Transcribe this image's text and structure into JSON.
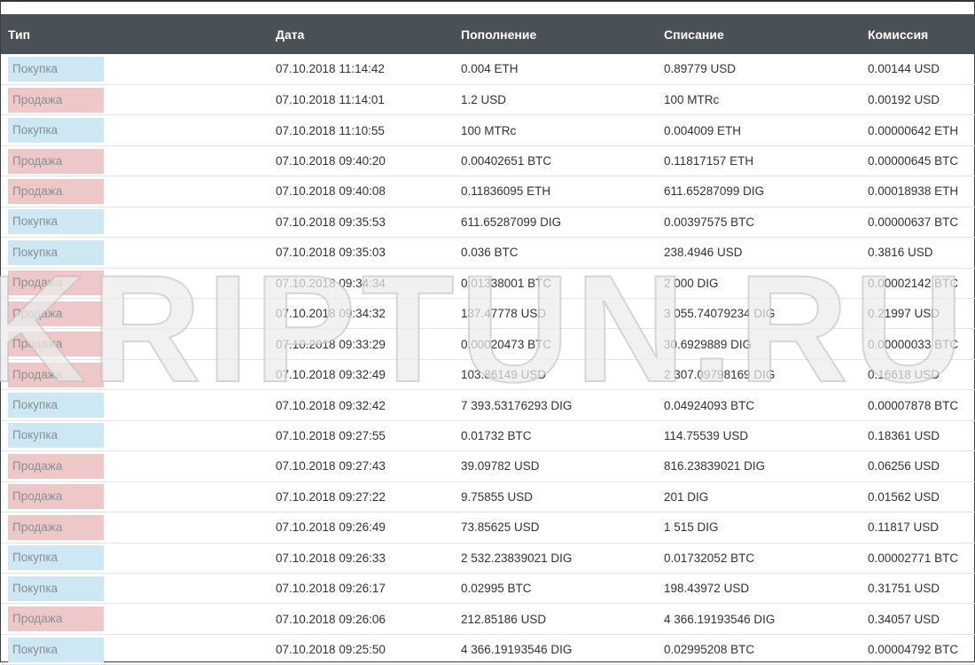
{
  "table": {
    "headers": {
      "type": "Тип",
      "date": "Дата",
      "deposit": "Пополнение",
      "withdrawal": "Списание",
      "fee": "Комиссия"
    },
    "rows": [
      {
        "type": "Покупка",
        "kind": "buy",
        "date": "07.10.2018 11:14:42",
        "deposit": "0.004 ETH",
        "withdrawal": "0.89779 USD",
        "fee": "0.00144 USD"
      },
      {
        "type": "Продажа",
        "kind": "sell",
        "date": "07.10.2018 11:14:01",
        "deposit": "1.2 USD",
        "withdrawal": "100 MTRc",
        "fee": "0.00192 USD"
      },
      {
        "type": "Покупка",
        "kind": "buy",
        "date": "07.10.2018 11:10:55",
        "deposit": "100 MTRc",
        "withdrawal": "0.004009 ETH",
        "fee": "0.00000642 ETH"
      },
      {
        "type": "Продажа",
        "kind": "sell",
        "date": "07.10.2018 09:40:20",
        "deposit": "0.00402651 BTC",
        "withdrawal": "0.11817157 ETH",
        "fee": "0.00000645 BTC"
      },
      {
        "type": "Продажа",
        "kind": "sell",
        "date": "07.10.2018 09:40:08",
        "deposit": "0.11836095 ETH",
        "withdrawal": "611.65287099 DIG",
        "fee": "0.00018938 ETH"
      },
      {
        "type": "Покупка",
        "kind": "buy",
        "date": "07.10.2018 09:35:53",
        "deposit": "611.65287099 DIG",
        "withdrawal": "0.00397575 BTC",
        "fee": "0.00000637 BTC"
      },
      {
        "type": "Покупка",
        "kind": "buy",
        "date": "07.10.2018 09:35:03",
        "deposit": "0.036 BTC",
        "withdrawal": "238.4946 USD",
        "fee": "0.3816 USD"
      },
      {
        "type": "Продажа",
        "kind": "sell",
        "date": "07.10.2018 09:34:34",
        "deposit": "0.01338001 BTC",
        "withdrawal": "2 000 DIG",
        "fee": "0.00002142 BTC"
      },
      {
        "type": "Продажа",
        "kind": "sell",
        "date": "07.10.2018 09:34:32",
        "deposit": "137.47778 USD",
        "withdrawal": "3 055.74079234 DIG",
        "fee": "0.21997 USD"
      },
      {
        "type": "Продажа",
        "kind": "sell",
        "date": "07.10.2018 09:33:29",
        "deposit": "0.00020473 BTC",
        "withdrawal": "30.6929889 DIG",
        "fee": "0.00000033 BTC"
      },
      {
        "type": "Продажа",
        "kind": "sell",
        "date": "07.10.2018 09:32:49",
        "deposit": "103.86149 USD",
        "withdrawal": "2 307.09798169 DIG",
        "fee": "0.16618 USD"
      },
      {
        "type": "Покупка",
        "kind": "buy",
        "date": "07.10.2018 09:32:42",
        "deposit": "7 393.53176293 DIG",
        "withdrawal": "0.04924093 BTC",
        "fee": "0.00007878 BTC"
      },
      {
        "type": "Покупка",
        "kind": "buy",
        "date": "07.10.2018 09:27:55",
        "deposit": "0.01732 BTC",
        "withdrawal": "114.75539 USD",
        "fee": "0.18361 USD"
      },
      {
        "type": "Продажа",
        "kind": "sell",
        "date": "07.10.2018 09:27:43",
        "deposit": "39.09782 USD",
        "withdrawal": "816.23839021 DIG",
        "fee": "0.06256 USD"
      },
      {
        "type": "Продажа",
        "kind": "sell",
        "date": "07.10.2018 09:27:22",
        "deposit": "9.75855 USD",
        "withdrawal": "201 DIG",
        "fee": "0.01562 USD"
      },
      {
        "type": "Продажа",
        "kind": "sell",
        "date": "07.10.2018 09:26:49",
        "deposit": "73.85625 USD",
        "withdrawal": "1 515 DIG",
        "fee": "0.11817 USD"
      },
      {
        "type": "Покупка",
        "kind": "buy",
        "date": "07.10.2018 09:26:33",
        "deposit": "2 532.23839021 DIG",
        "withdrawal": "0.01732052 BTC",
        "fee": "0.00002771 BTC"
      },
      {
        "type": "Покупка",
        "kind": "buy",
        "date": "07.10.2018 09:26:17",
        "deposit": "0.02995 BTC",
        "withdrawal": "198.43972 USD",
        "fee": "0.31751 USD"
      },
      {
        "type": "Продажа",
        "kind": "sell",
        "date": "07.10.2018 09:26:06",
        "deposit": "212.85186 USD",
        "withdrawal": "4 366.19193546 DIG",
        "fee": "0.34057 USD"
      },
      {
        "type": "Покупка",
        "kind": "buy",
        "date": "07.10.2018 09:25:50",
        "deposit": "4 366.19193546 DIG",
        "withdrawal": "0.02995208 BTC",
        "fee": "0.00004792 BTC"
      }
    ]
  },
  "watermark": "KRIPTUN.RU",
  "colors": {
    "header_bg": "#4a5156",
    "buy_badge": "#cde7f3",
    "sell_badge": "#eec8c9"
  }
}
